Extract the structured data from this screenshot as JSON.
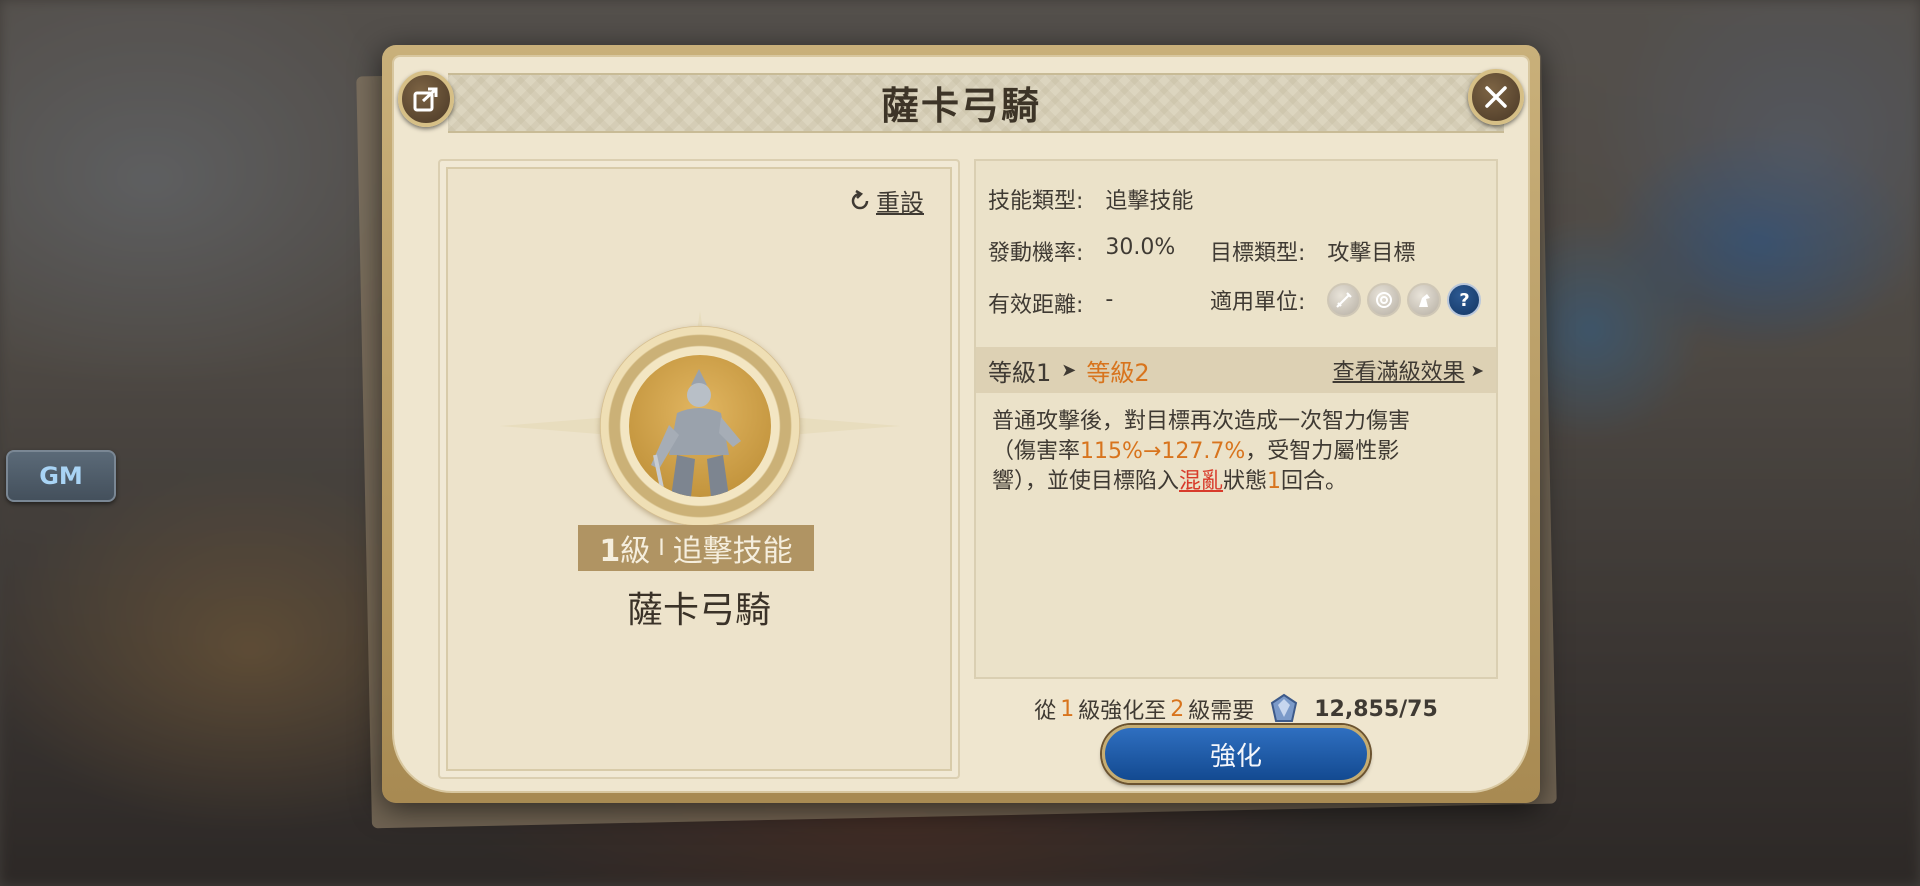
{
  "gm_label": "GM",
  "dialog": {
    "title": "薩卡弓騎",
    "reset_label": "重設",
    "skill": {
      "level_num": "1",
      "level_unit": "級",
      "separator": "I",
      "type_tag": "追擊技能",
      "name": "薩卡弓騎"
    },
    "info": {
      "skill_type_key": "技能類型:",
      "skill_type_value": "追擊技能",
      "trigger_rate_key": "發動機率:",
      "trigger_rate_value": "30.0%",
      "target_type_key": "目標類型:",
      "target_type_value": "攻擊目標",
      "range_key": "有效距離:",
      "range_value": "-",
      "units_key": "適用單位:",
      "units": [
        "sword-unit-icon",
        "archer-unit-icon",
        "cavalry-unit-icon",
        "help-icon"
      ]
    },
    "levels": {
      "current": "等級1",
      "next": "等級2",
      "max_link": "查看滿級效果"
    },
    "description": {
      "p1": "普通攻擊後，對目標再次造成一次智力傷害（傷害率",
      "rate": "115%→127.7%",
      "p2": "，受智力屬性影響），並使目標陷入",
      "status": "混亂",
      "p3": "狀態",
      "turns": "1",
      "p4": "回合。"
    },
    "cost": {
      "from_prefix": "從",
      "from_level": "1",
      "mid1": "級強化至",
      "to_level": "2",
      "mid2": "級需要",
      "value": "12,855/75"
    },
    "upgrade_label": "強化"
  },
  "colors": {
    "accent_orange": "#d8741d",
    "status_red": "#d83a2a",
    "button_blue": "#1d5aa6"
  }
}
